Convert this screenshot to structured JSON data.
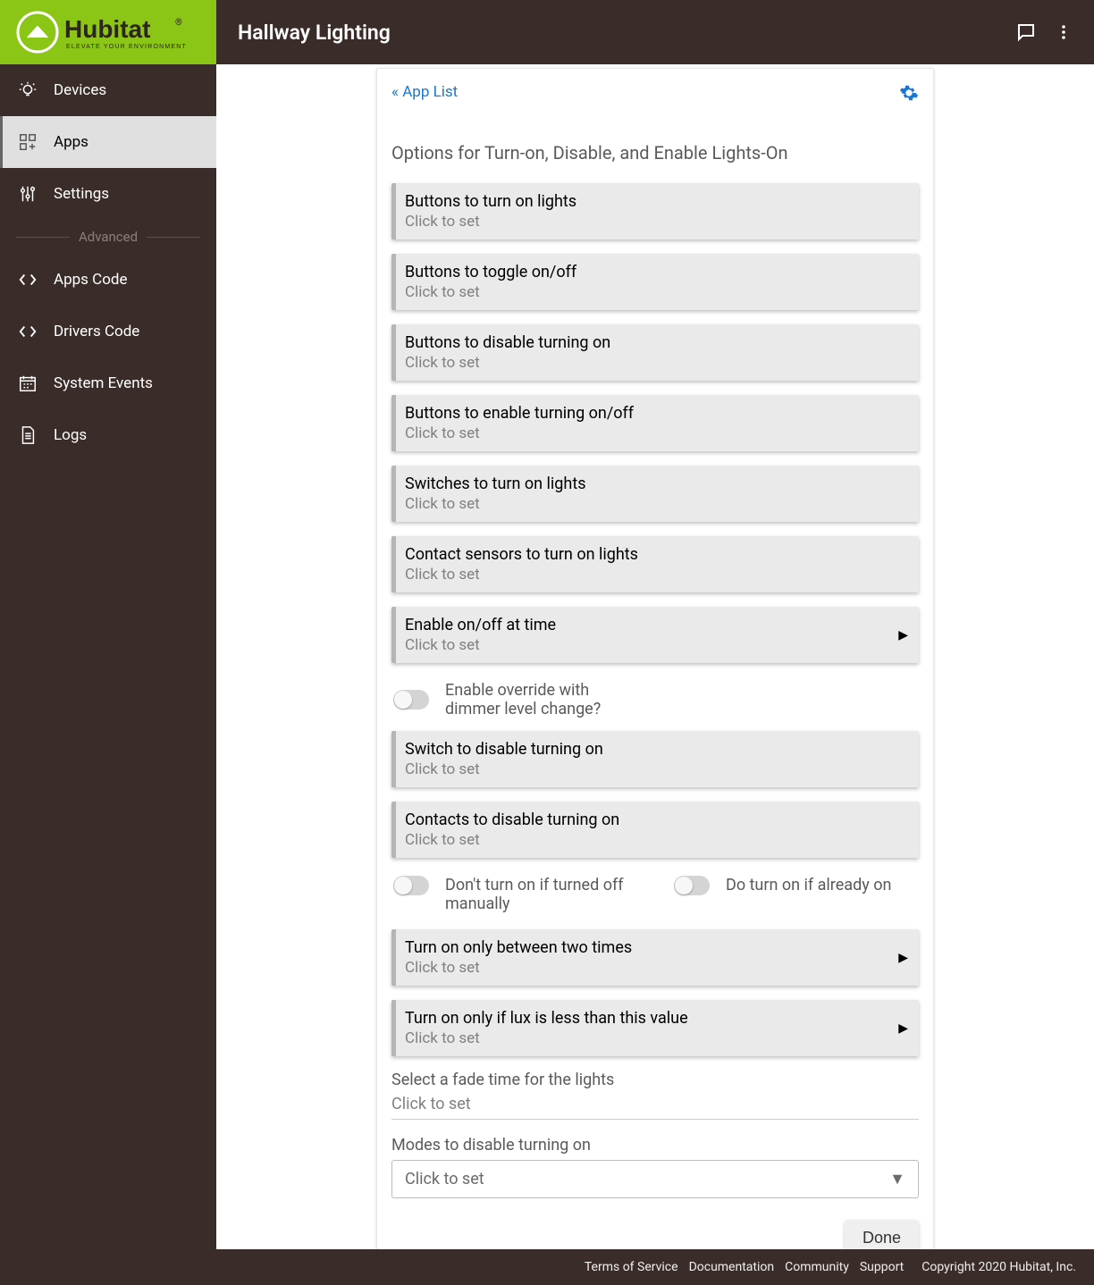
{
  "brand": {
    "name": "Hubitat",
    "tagline": "ELEVATE YOUR ENVIRONMENT"
  },
  "header": {
    "title": "Hallway Lighting"
  },
  "sidebar": {
    "items": [
      {
        "label": "Devices"
      },
      {
        "label": "Apps"
      },
      {
        "label": "Settings"
      }
    ],
    "advanced_label": "Advanced",
    "advanced": [
      {
        "label": "Apps Code"
      },
      {
        "label": "Drivers Code"
      },
      {
        "label": "System Events"
      },
      {
        "label": "Logs"
      }
    ]
  },
  "card": {
    "back": "« App List",
    "heading": "Options for Turn-on, Disable, and Enable Lights-On",
    "click_to_set": "Click to set",
    "rows": [
      {
        "label": "Buttons to turn on lights"
      },
      {
        "label": "Buttons to toggle on/off"
      },
      {
        "label": "Buttons to disable turning on"
      },
      {
        "label": "Buttons to enable turning on/off"
      },
      {
        "label": "Switches to turn on lights"
      },
      {
        "label": "Contact sensors to turn on lights"
      },
      {
        "label": "Enable on/off at time",
        "chevron": true
      }
    ],
    "toggle1": {
      "label": "Enable override with dimmer level change?"
    },
    "rows2": [
      {
        "label": "Switch to disable turning on"
      },
      {
        "label": "Contacts to disable turning on"
      }
    ],
    "toggle2a": {
      "label": "Don't turn on if turned off manually"
    },
    "toggle2b": {
      "label": "Do turn on if already on"
    },
    "rows3": [
      {
        "label": "Turn on only between two times",
        "chevron": true
      },
      {
        "label": "Turn on only if lux is less than this value",
        "chevron": true
      }
    ],
    "fade": {
      "label": "Select a fade time for the lights"
    },
    "modes": {
      "label": "Modes to disable turning on"
    },
    "done": "Done"
  },
  "footer": {
    "links": [
      "Terms of Service",
      "Documentation",
      "Community",
      "Support"
    ],
    "copyright": "Copyright 2020 Hubitat, Inc."
  }
}
